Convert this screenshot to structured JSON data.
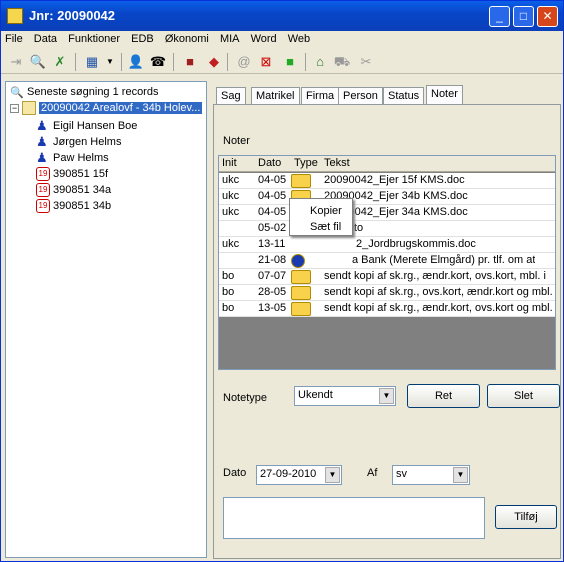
{
  "window": {
    "title": "Jnr: 20090042"
  },
  "menu": [
    "File",
    "Data",
    "Funktioner",
    "EDB",
    "Økonomi",
    "MIA",
    "Word",
    "Web"
  ],
  "tree": {
    "search_label": "Seneste søgning 1 records",
    "root_label": "20090042 Arealovf - 34b Holev...",
    "persons": [
      "Eigil Hansen Boe",
      "Jørgen Helms",
      "Paw Helms"
    ],
    "matrikler": [
      "390851 15f",
      "390851 34a",
      "390851 34b"
    ],
    "matrikel_badge": "19"
  },
  "tabs": [
    "Sag",
    "Matrikel",
    "Firma",
    "Person",
    "Status",
    "Noter"
  ],
  "active_tab": "Noter",
  "noter": {
    "label": "Noter",
    "columns": [
      "Init",
      "Dato",
      "Type",
      "Tekst"
    ],
    "rows": [
      {
        "init": "ukc",
        "dato": "04-05",
        "tekst": "20090042_Ejer 15f KMS.doc"
      },
      {
        "init": "ukc",
        "dato": "04-05",
        "tekst": "20090042_Ejer 34b KMS.doc"
      },
      {
        "init": "ukc",
        "dato": "04-05",
        "tekst": "20090042_Ejer 34a KMS.doc"
      },
      {
        "init": "",
        "dato": "05-02",
        "tekst": "to"
      },
      {
        "init": "ukc",
        "dato": "13-11",
        "tekst": "2_Jordbrugskommis.doc"
      },
      {
        "init": "",
        "dato": "21-08",
        "tekst": "a Bank (Merete Elmgård) pr. tlf. om at"
      },
      {
        "init": "bo",
        "dato": "07-07",
        "tekst": "sendt kopi af sk.rg., ændr.kort, ovs.kort, mbl. i"
      },
      {
        "init": "bo",
        "dato": "28-05",
        "tekst": "sendt kopi af sk.rg., ovs.kort, ændr.kort og mbl."
      },
      {
        "init": "bo",
        "dato": "13-05",
        "tekst": "sendt kopi af sk.rg., ændr.kort, ovs.kort og mbl."
      }
    ],
    "context_menu": [
      "Kopier",
      "Sæt fil"
    ],
    "notetype_label": "Notetype",
    "notetype_value": "Ukendt",
    "ret_label": "Ret",
    "slet_label": "Slet",
    "dato_label": "Dato",
    "dato_value": "27-09-2010",
    "af_label": "Af",
    "af_value": "sv",
    "tilfoj_label": "Tilføj"
  }
}
